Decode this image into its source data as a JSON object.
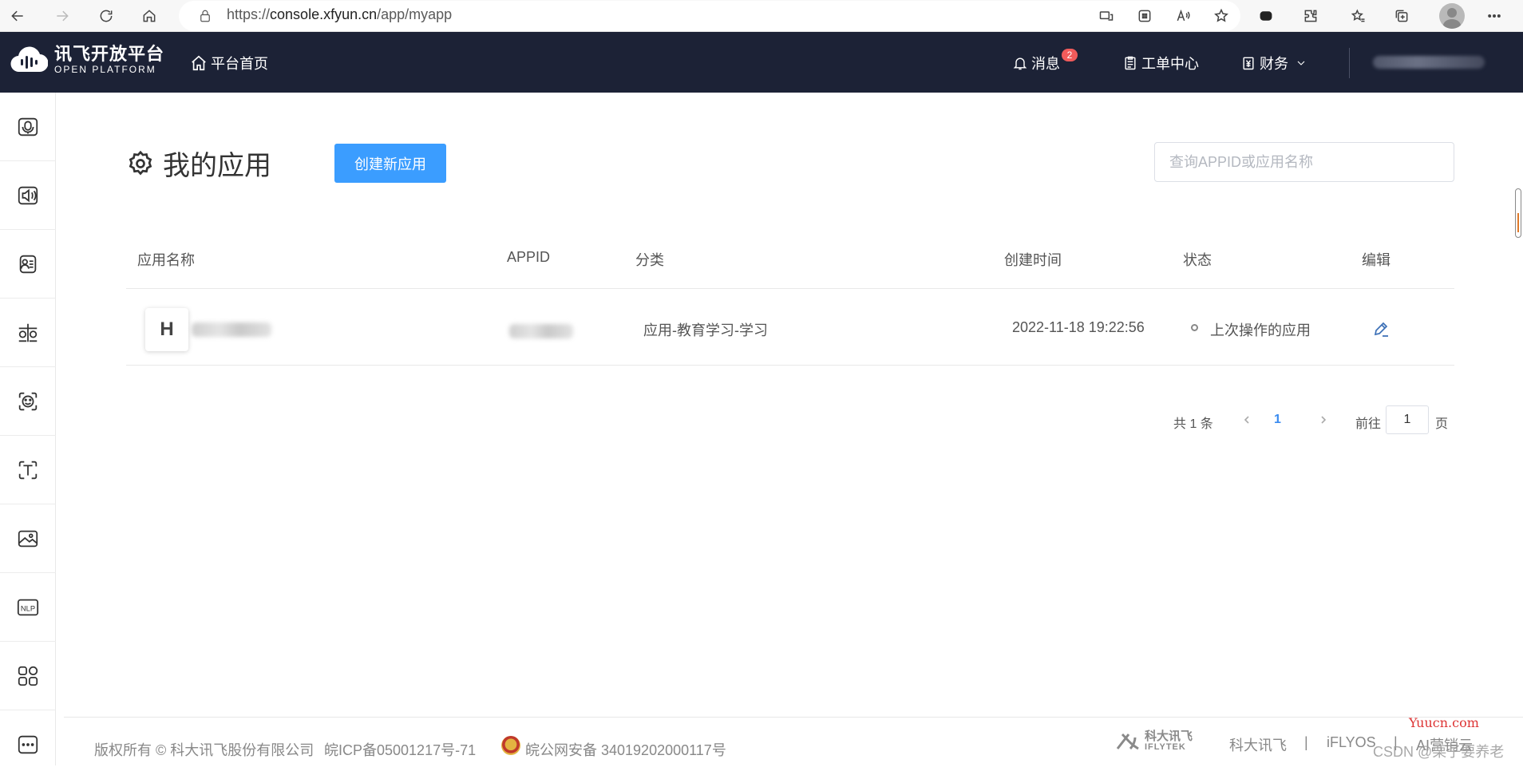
{
  "browser": {
    "url_prefix": "https://",
    "url_host": "console.xfyun.cn",
    "url_path": "/app/myapp"
  },
  "nav": {
    "logo_cn": "讯飞开放平台",
    "logo_en": "OPEN PLATFORM",
    "home": "平台首页",
    "messages": "消息",
    "messages_badge": "2",
    "tickets": "工单中心",
    "finance": "财务"
  },
  "sidebar": {
    "items": [
      {
        "icon": "speech-recognition-icon"
      },
      {
        "icon": "speech-synthesis-icon"
      },
      {
        "icon": "voice-print-icon"
      },
      {
        "icon": "face-compare-icon"
      },
      {
        "icon": "face-recognition-icon"
      },
      {
        "icon": "text-recognition-icon"
      },
      {
        "icon": "image-recognition-icon"
      },
      {
        "icon": "nlp-icon"
      },
      {
        "icon": "apps-grid-icon"
      },
      {
        "icon": "more-icon"
      }
    ]
  },
  "main": {
    "title": "我的应用",
    "create_button": "创建新应用",
    "search_placeholder": "查询APPID或应用名称"
  },
  "table": {
    "headers": [
      "应用名称",
      "APPID",
      "分类",
      "创建时间",
      "状态",
      "编辑"
    ],
    "rows": [
      {
        "avatar_letter": "H",
        "category": "应用-教育学习-学习",
        "created": "2022-11-18 19:22:56",
        "status": "上次操作的应用"
      }
    ]
  },
  "pagination": {
    "total": "共 1 条",
    "current": "1",
    "goto": "前往",
    "input_value": "1",
    "unit": "页"
  },
  "footer": {
    "copyright": "版权所有 © 科大讯飞股份有限公司",
    "icp": "皖ICP备05001217号-71",
    "police": "皖公网安备 34019202000117号",
    "logo_cn": "科大讯飞",
    "logo_en": "IFLYTEK",
    "link1": "科大讯飞",
    "sep1": "|",
    "link2": "iFLYOS",
    "sep2": "|",
    "link3": "AI营销云"
  },
  "watermark": {
    "site": "Yuucn.com",
    "csdn": "CSDN @栗子要养老"
  }
}
